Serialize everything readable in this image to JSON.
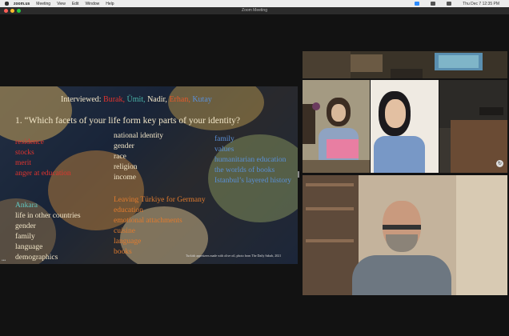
{
  "menubar": {
    "app": "zoom.us",
    "items": [
      "Meeting",
      "View",
      "Edit",
      "Window",
      "Help"
    ],
    "clock": "Thu Dec 7 12:35 PM"
  },
  "window": {
    "title": "Zoom Meeting"
  },
  "slide": {
    "interviewed_label": "Interviewed:",
    "interviewees": [
      {
        "name": "Burak,",
        "color": "#e0342e"
      },
      {
        "name": "Ümit,",
        "color": "#4ab3a8"
      },
      {
        "name": "Nadir,",
        "color": "#f2e6c8"
      },
      {
        "name": "Erhan,",
        "color": "#e35a2c"
      },
      {
        "name": "Kutay",
        "color": "#5a8fd6"
      }
    ],
    "question": "1.   “Which facets of your life form key parts of your identity?",
    "col_red": [
      "residence",
      "stocks",
      "merit",
      "anger at education"
    ],
    "col_white_top": [
      "national identity",
      "gender",
      "race",
      "religion",
      "income"
    ],
    "col_blue": [
      "family",
      "values",
      "humanitarian education",
      "the worlds of books",
      "Istanbul’s layered history"
    ],
    "col_teal": [
      "Ankara",
      "life in other countries",
      "gender",
      "family",
      "language",
      "demographics"
    ],
    "col_orange": [
      "Leaving Türkiye for Germany",
      "education",
      "emotional attachments",
      "cuisine",
      "language",
      "books"
    ],
    "caption": "Turkish appetizers made with olive oil, photo from The Daily Sabah, 2021"
  },
  "colors": {
    "red": "#e0342e",
    "white": "#f2e6c8",
    "blue": "#5a8fd6",
    "teal": "#62c6c0",
    "orange": "#e07b2e"
  }
}
